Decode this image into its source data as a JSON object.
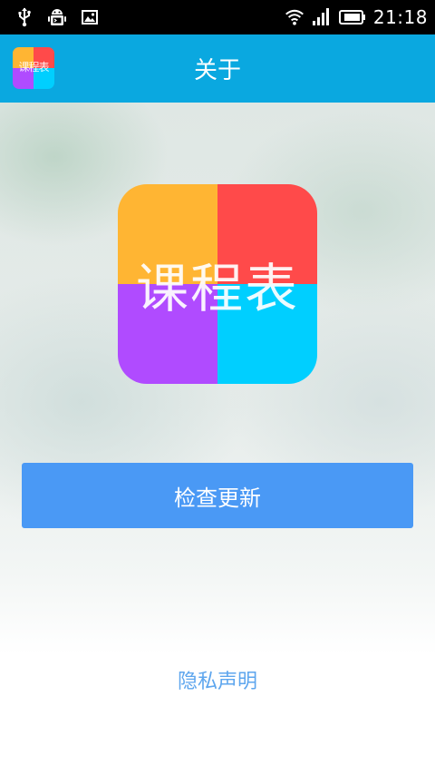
{
  "status_bar": {
    "time": "21:18",
    "icons": [
      "usb-icon",
      "android-debug-icon",
      "image-notification-icon",
      "wifi-icon",
      "signal-icon",
      "battery-icon"
    ]
  },
  "app_bar": {
    "title": "关于",
    "logo_text": "课程表"
  },
  "main": {
    "logo_text": "课程表",
    "logo_colors": {
      "top_left": "#ffb533",
      "top_right": "#ff4a4a",
      "bottom_left": "#b04bff",
      "bottom_right": "#00cfff"
    },
    "check_update_label": "检查更新",
    "privacy_label": "隐私声明"
  },
  "colors": {
    "app_bar": "#0aa8e0",
    "button": "#4a99f5",
    "link": "#5ea6ee"
  }
}
